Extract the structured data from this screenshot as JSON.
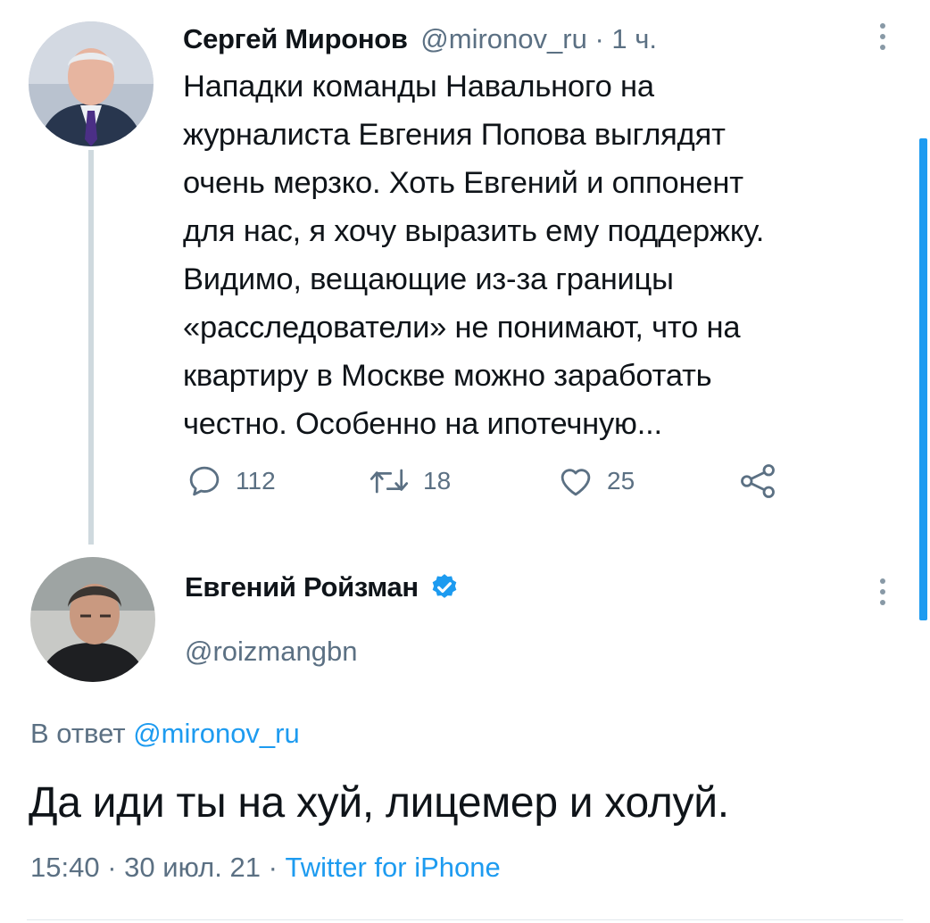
{
  "parent_tweet": {
    "author_name": "Сергей Миронов",
    "handle": "@mironov_ru",
    "separator": "·",
    "time": "1 ч.",
    "text_lines": [
      "Нападки команды Навального на",
      "журналиста Евгения Попова выглядят",
      "очень мерзко. Хоть Евгений и оппонент",
      "для нас, я хочу выразить ему поддержку.",
      "Видимо, вещающие из-за границы",
      "«расследователи» не понимают, что на",
      "квартиру в Москве можно заработать",
      "честно. Особенно на ипотечную..."
    ],
    "actions": {
      "replies": "112",
      "retweets": "18",
      "likes": "25"
    }
  },
  "main_tweet": {
    "author_name": "Евгений Ройзман",
    "verified": true,
    "handle": "@roizmangbn",
    "reply_prefix": "В ответ",
    "reply_to": "@mironov_ru",
    "text": "Да иди ты на хуй, лицемер и холуй.",
    "meta": {
      "time": "15:40",
      "separator": "·",
      "date": "30 июл. 21",
      "source": "Twitter for iPhone"
    }
  },
  "colors": {
    "accent": "#1d9bf0",
    "muted": "#5b7083",
    "thread_line": "#cfd9de"
  },
  "icons": [
    "reply-icon",
    "retweet-icon",
    "like-icon",
    "share-icon",
    "more-icon",
    "verified-badge-icon"
  ]
}
